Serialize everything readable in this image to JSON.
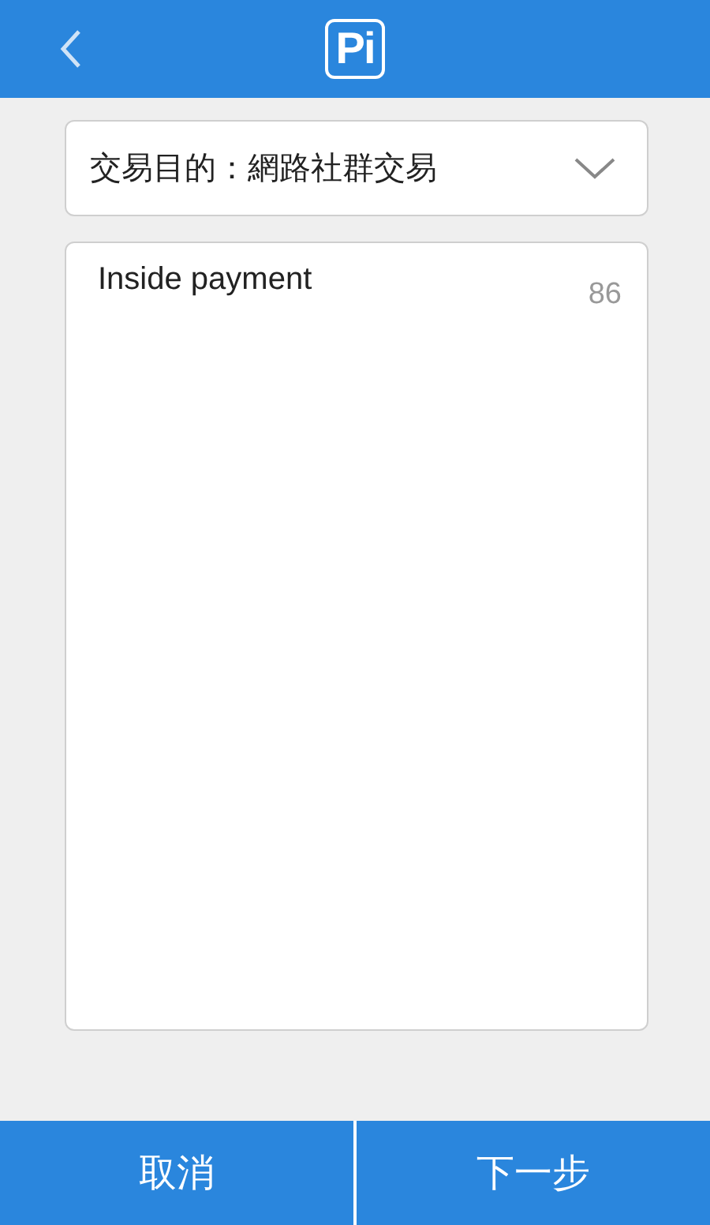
{
  "header": {
    "logo": "Pi"
  },
  "purpose_select": {
    "value": "交易目的：網路社群交易"
  },
  "memo": {
    "value": "Inside payment",
    "remaining": "86"
  },
  "buttons": [
    {
      "label": "取消"
    },
    {
      "label": "下一步"
    }
  ]
}
